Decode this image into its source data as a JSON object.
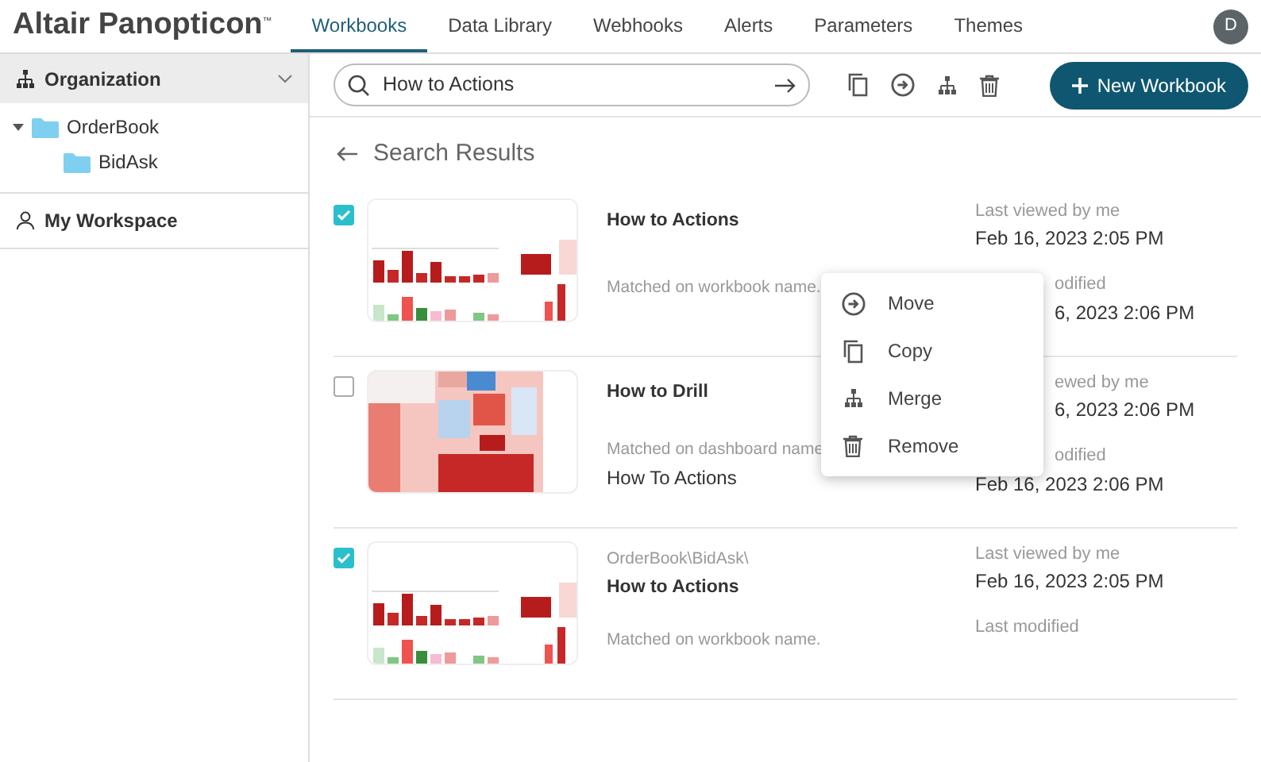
{
  "brand": {
    "name": "Altair Panopticon",
    "mark": "™"
  },
  "tabs": [
    {
      "label": "Workbooks",
      "selected": true
    },
    {
      "label": "Data Library",
      "selected": false
    },
    {
      "label": "Webhooks",
      "selected": false
    },
    {
      "label": "Alerts",
      "selected": false
    },
    {
      "label": "Parameters",
      "selected": false
    },
    {
      "label": "Themes",
      "selected": false
    }
  ],
  "user": {
    "initial": "D"
  },
  "sidebar": {
    "header": "Organization",
    "tree": [
      {
        "label": "OrderBook",
        "expanded": true,
        "children": [
          {
            "label": "BidAsk"
          }
        ]
      }
    ],
    "workspace": "My Workspace"
  },
  "search": {
    "value": "How to Actions"
  },
  "new_button": "New Workbook",
  "results_title": "Search Results",
  "results": [
    {
      "checked": true,
      "kind": "picture",
      "title": "How to Actions",
      "match": "Matched on workbook name.",
      "meta": [
        {
          "text": "Last viewed by me",
          "kind": "label",
          "cut": false
        },
        {
          "text": "Feb 16, 2023 2:05 PM",
          "kind": "date",
          "cut": false
        },
        {
          "text": "odified",
          "kind": "label",
          "cut": true
        },
        {
          "text": "6, 2023 2:06 PM",
          "kind": "date",
          "cut": true
        }
      ]
    },
    {
      "checked": false,
      "kind": "picture",
      "title": "How to Drill",
      "match": "Matched on dashboard name",
      "match_detail": "How To Actions",
      "meta": [
        {
          "text": "ewed by me",
          "kind": "label",
          "cut": true
        },
        {
          "text": "6, 2023 2:06 PM",
          "kind": "date",
          "cut": true
        },
        {
          "text": "odified",
          "kind": "label",
          "cut": true
        },
        {
          "text": "Feb 16, 2023 2:06 PM",
          "kind": "date",
          "cut": false
        }
      ]
    },
    {
      "checked": true,
      "kind": "picture",
      "path": "OrderBook\\BidAsk\\",
      "title": "How to Actions",
      "match": "Matched on workbook name.",
      "meta": [
        {
          "text": "Last viewed by me",
          "kind": "label",
          "cut": false
        },
        {
          "text": "Feb 16, 2023 2:05 PM",
          "kind": "date",
          "cut": false
        },
        {
          "text": "Last modified",
          "kind": "label",
          "cut": false
        }
      ]
    }
  ],
  "context_menu": [
    {
      "label": "Move"
    },
    {
      "label": "Copy"
    },
    {
      "label": "Merge"
    },
    {
      "label": "Remove"
    }
  ]
}
